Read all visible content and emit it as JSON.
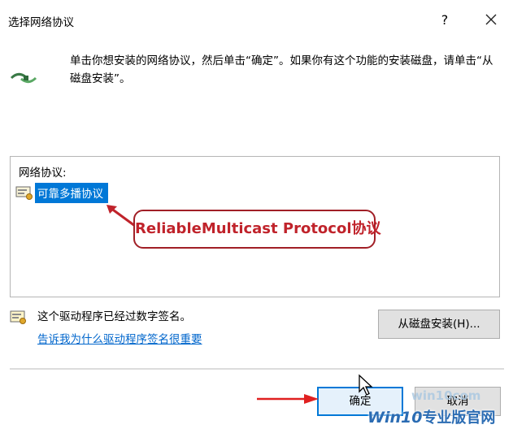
{
  "dialog": {
    "title": "选择网络协议",
    "help_glyph": "?",
    "instruction": "单击你想安装的网络协议，然后单击“确定”。如果你有这个功能的安装磁盘，请单击“从磁盘安装”。",
    "list_label": "网络协议:",
    "items": [
      {
        "label": "可靠多播协议"
      }
    ],
    "callout": "ReliableMulticast Protocol协议",
    "signature_text": "这个驱动程序已经过数字签名。",
    "signature_link": "告诉我为什么驱动程序签名很重要",
    "install_from_disk_label": "从磁盘安装(H)...",
    "ok_label": "确定",
    "cancel_label": "取消"
  },
  "watermark": {
    "line1": "win10com",
    "line2_brand": "Win10",
    "line2_suffix": "专业版官网"
  },
  "icons": {
    "protocol": "network-protocol-icon",
    "list_item": "protocol-item-icon",
    "signature": "certificate-icon",
    "close": "close-icon",
    "cursor": "mouse-pointer-icon"
  },
  "colors": {
    "selection": "#0078d7",
    "callout": "#c0232b",
    "link": "#0066cc"
  }
}
